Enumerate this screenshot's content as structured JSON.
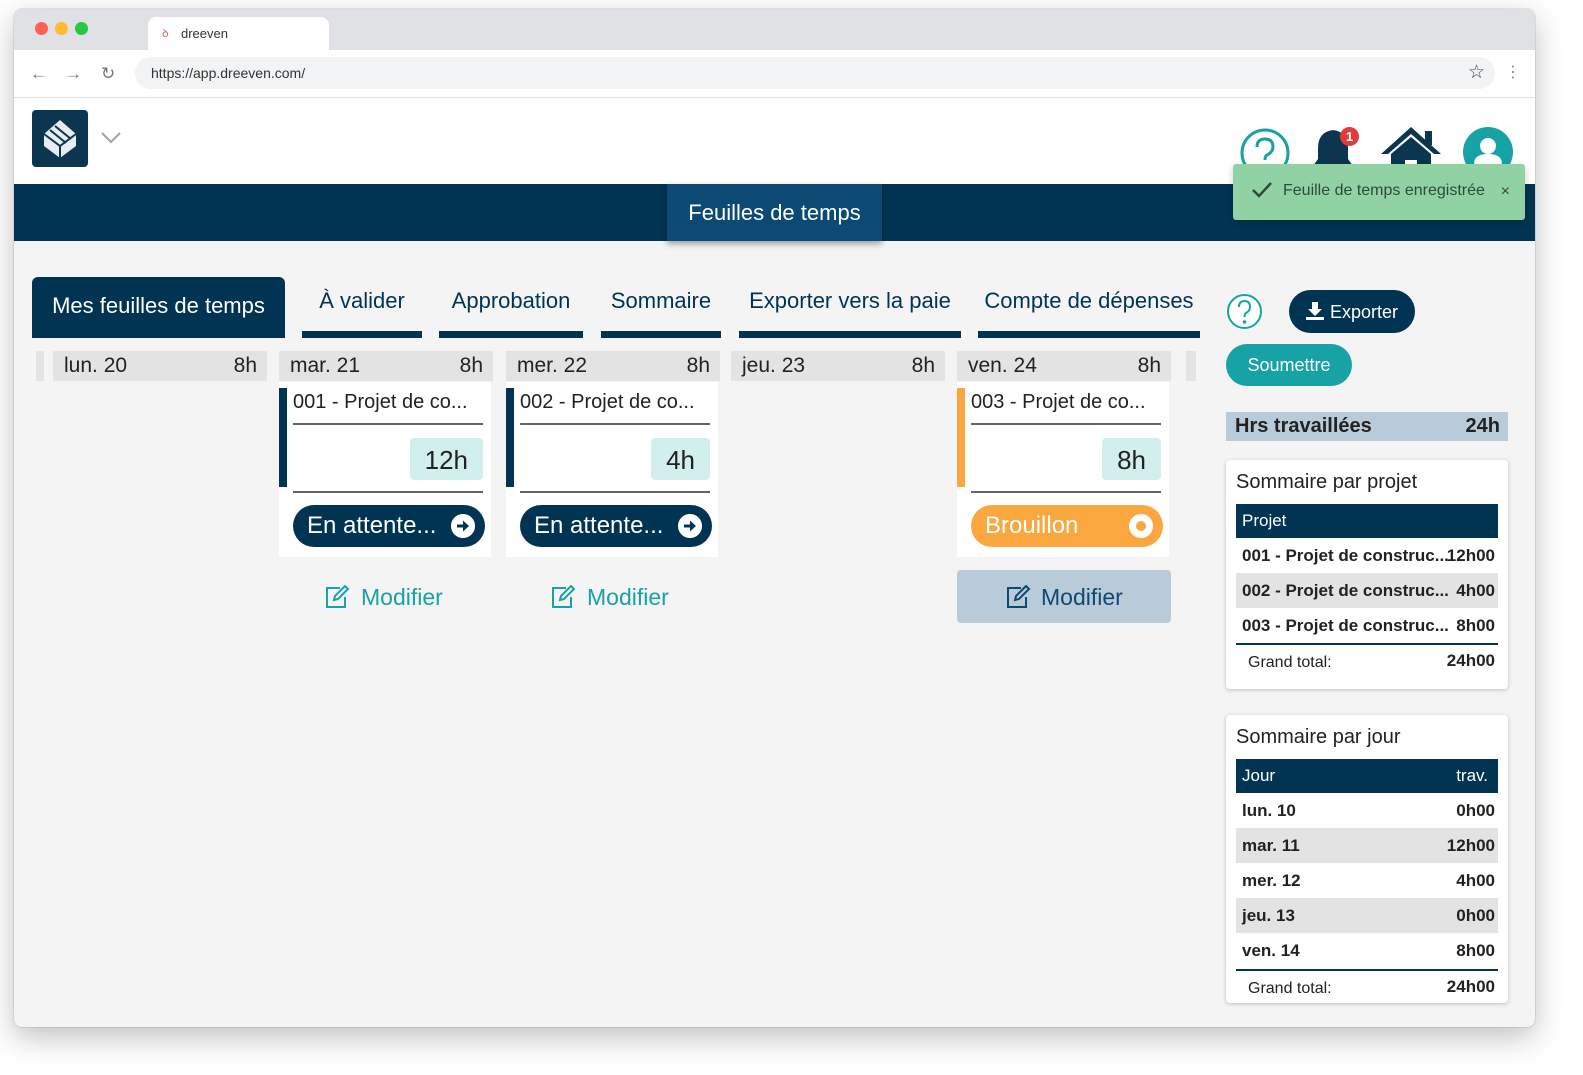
{
  "browser": {
    "tab_title": "dreeven",
    "url": "https://app.dreeven.com/"
  },
  "colors": {
    "primary": "#003452",
    "accent": "#17a2a6",
    "draft": "#f9a73e",
    "success_toast": "#90d2a4",
    "badge": "#e03b3b"
  },
  "header": {
    "notification_count": "1",
    "icons": [
      "help-icon",
      "bell-icon",
      "home-icon",
      "user-icon"
    ]
  },
  "nav": {
    "active": "Feuilles de temps"
  },
  "toast": {
    "message": "Feuille de temps enregistrée",
    "close": "×"
  },
  "tabs": {
    "active": "Mes feuilles de temps",
    "items": [
      "À valider",
      "Approbation",
      "Sommaire",
      "Exporter vers la paie",
      "Compte de dépenses"
    ]
  },
  "actions": {
    "export": "Exporter",
    "submit": "Soumettre"
  },
  "days": [
    {
      "name": "lun. 20",
      "hours": "8h"
    },
    {
      "name": "mar. 21",
      "hours": "8h"
    },
    {
      "name": "mer. 22",
      "hours": "8h"
    },
    {
      "name": "jeu. 23",
      "hours": "8h"
    },
    {
      "name": "ven. 24",
      "hours": "8h"
    }
  ],
  "cards": [
    {
      "project": "001 - Projet de co...",
      "hours": "12h",
      "status": "En attente...",
      "modify": "Modifier"
    },
    {
      "project": "002 - Projet de co...",
      "hours": "4h",
      "status": "En attente...",
      "modify": "Modifier"
    },
    {
      "project": "003 - Projet de co...",
      "hours": "8h",
      "status": "Brouillon",
      "modify": "Modifier"
    }
  ],
  "worked": {
    "label": "Hrs travaillées",
    "value": "24h"
  },
  "project_summary": {
    "title": "Sommaire par projet",
    "header": "Projet",
    "rows": [
      {
        "name": "001 - Projet de construc...",
        "value": "12h00"
      },
      {
        "name": "002 - Projet de construc...",
        "value": "4h00"
      },
      {
        "name": "003 - Projet de construc...",
        "value": "8h00"
      }
    ],
    "total_label": "Grand total:",
    "total_value": "24h00"
  },
  "day_summary": {
    "title": "Sommaire par jour",
    "header_day": "Jour",
    "header_worked": "trav.",
    "rows": [
      {
        "day": "lun. 10",
        "value": "0h00"
      },
      {
        "day": "mar. 11",
        "value": "12h00"
      },
      {
        "day": "mer. 12",
        "value": "4h00"
      },
      {
        "day": "jeu. 13",
        "value": "0h00"
      },
      {
        "day": "ven. 14",
        "value": "8h00"
      }
    ],
    "total_label": "Grand total:",
    "total_value": "24h00"
  }
}
